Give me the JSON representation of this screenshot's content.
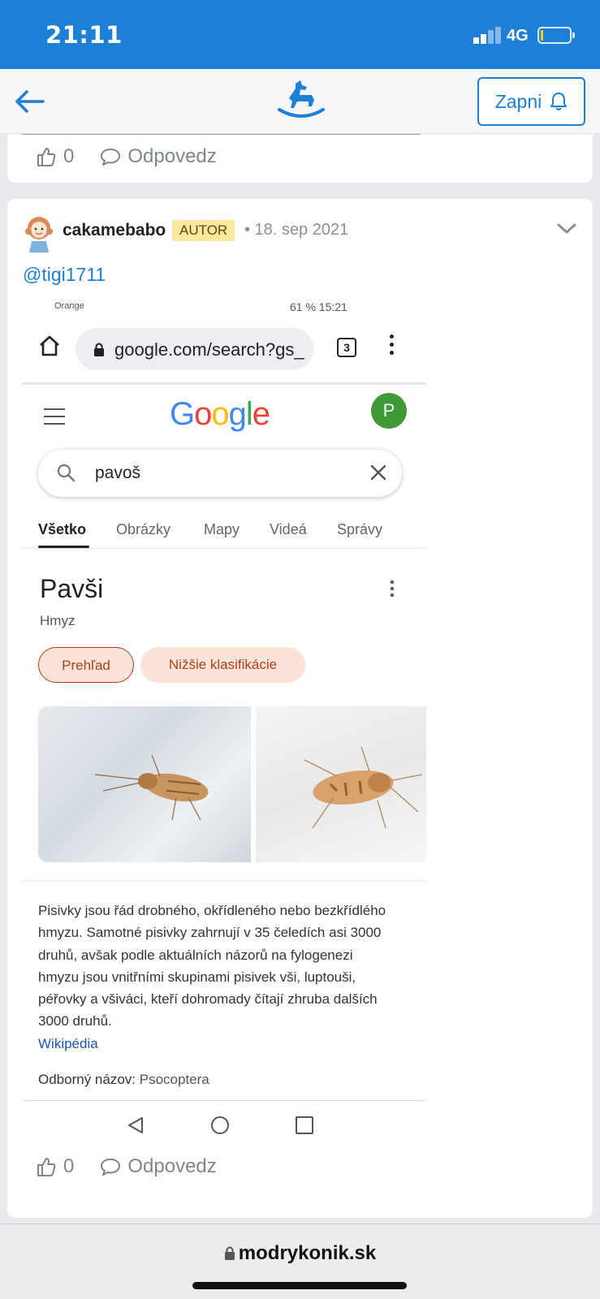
{
  "status_bar": {
    "time": "21:11",
    "network": "4G",
    "battery_color": "#f2d10a"
  },
  "app_bar": {
    "back_icon": "arrow-left-icon",
    "logo_icon": "rocking-horse-icon",
    "notify_label": "Zapni",
    "notify_icon": "bell-icon",
    "accent": "#1e7fd6"
  },
  "prev_comment": {
    "likes": "0",
    "reply_label": "Odpovedz"
  },
  "post": {
    "author": "cakamebabo",
    "badge": "AUTOR",
    "date": "• 18. sep 2021",
    "mention": "@tigi1711",
    "likes": "0",
    "reply_label": "Odpovedz"
  },
  "screenshot": {
    "android_status_left": "Orange",
    "android_status_right": "61 %  15:21",
    "url": "google.com/search?gs_",
    "tab_count": "3",
    "google_logo": "Google",
    "avatar_letter": "P",
    "search_query": "pavoš",
    "tabs": [
      "Všetko",
      "Obrázky",
      "Mapy",
      "Videá",
      "Správy"
    ],
    "kp_title": "Pavši",
    "kp_subtitle": "Hmyz",
    "chips": [
      "Prehľad",
      "Nižšie klasifikácie"
    ],
    "description": "Pisivky jsou řád drobného, okřídleného nebo bezkřídlého hmyzu. Samotné pisivky zahrnují v 35 čeledích asi 3000 druhů, avšak podle aktuálních názorů na fylogenezi hmyzu jsou vnitřními skupinami pisivek vši, luptouši, péřovky a všiváci, kteří dohromady čítají zhruba dalších 3000 druhů.",
    "wiki_link": "Wikipédia",
    "field_label": "Odborný názov:",
    "field_value": "Psocoptera"
  },
  "safari": {
    "domain": "modrykonik.sk"
  }
}
